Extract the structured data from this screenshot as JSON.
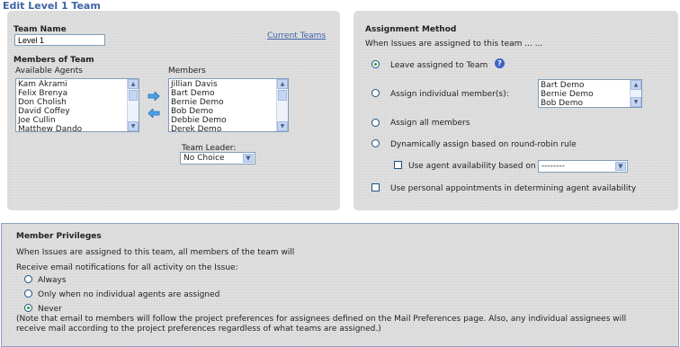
{
  "page": {
    "title": "Edit Level 1 Team"
  },
  "left": {
    "team_name_label": "Team Name",
    "team_name_value": "Level 1",
    "current_teams_link": "Current Teams",
    "members_of_team_label": "Members of Team",
    "available_agents_label": "Available Agents",
    "available_agents": [
      "Kam Akrami",
      "Felix Brenya",
      "Don Cholish",
      "David Coffey",
      "Joe Cullin",
      "Matthew Dando"
    ],
    "members_label": "Members",
    "members": [
      "Jillian Davis",
      "Bart Demo",
      "Bernie Demo",
      "Bob Demo",
      "Debbie Demo",
      "Derek Demo"
    ],
    "team_leader_label": "Team Leader:",
    "team_leader_value": "No Choice"
  },
  "right": {
    "assignment_method_label": "Assignment Method",
    "intro": "When Issues are assigned to this team ... ...",
    "options": {
      "leave_assigned": "Leave assigned to Team",
      "assign_individual": "Assign individual member(s):",
      "assign_all": "Assign all members",
      "round_robin": "Dynamically assign based on round-robin rule"
    },
    "individual_members": [
      "Bart Demo",
      "Bernie Demo",
      "Bob Demo"
    ],
    "use_agent_availability_label": "Use agent availability based on",
    "availability_select_value": "--------",
    "personal_appointments_label": "Use personal appointments in determining agent availability"
  },
  "privileges": {
    "title": "Member Privileges",
    "intro": "When Issues are assigned to this team, all members of the team will",
    "receive_label": "Receive email notifications for all activity on the Issue:",
    "options": {
      "always": "Always",
      "only_when": "Only when no individual agents are assigned",
      "never": "Never"
    },
    "note_line1": "(Note that email to members will follow the project preferences for assignees defined on the Mail Preferences page. Also, any individual assignees will",
    "note_line2": "receive mail according to the project preferences regardless of what teams are assigned.)"
  },
  "colors": {
    "title": "#3e64a6",
    "link": "#3c5fa8",
    "radio_selected": "#21a121"
  }
}
